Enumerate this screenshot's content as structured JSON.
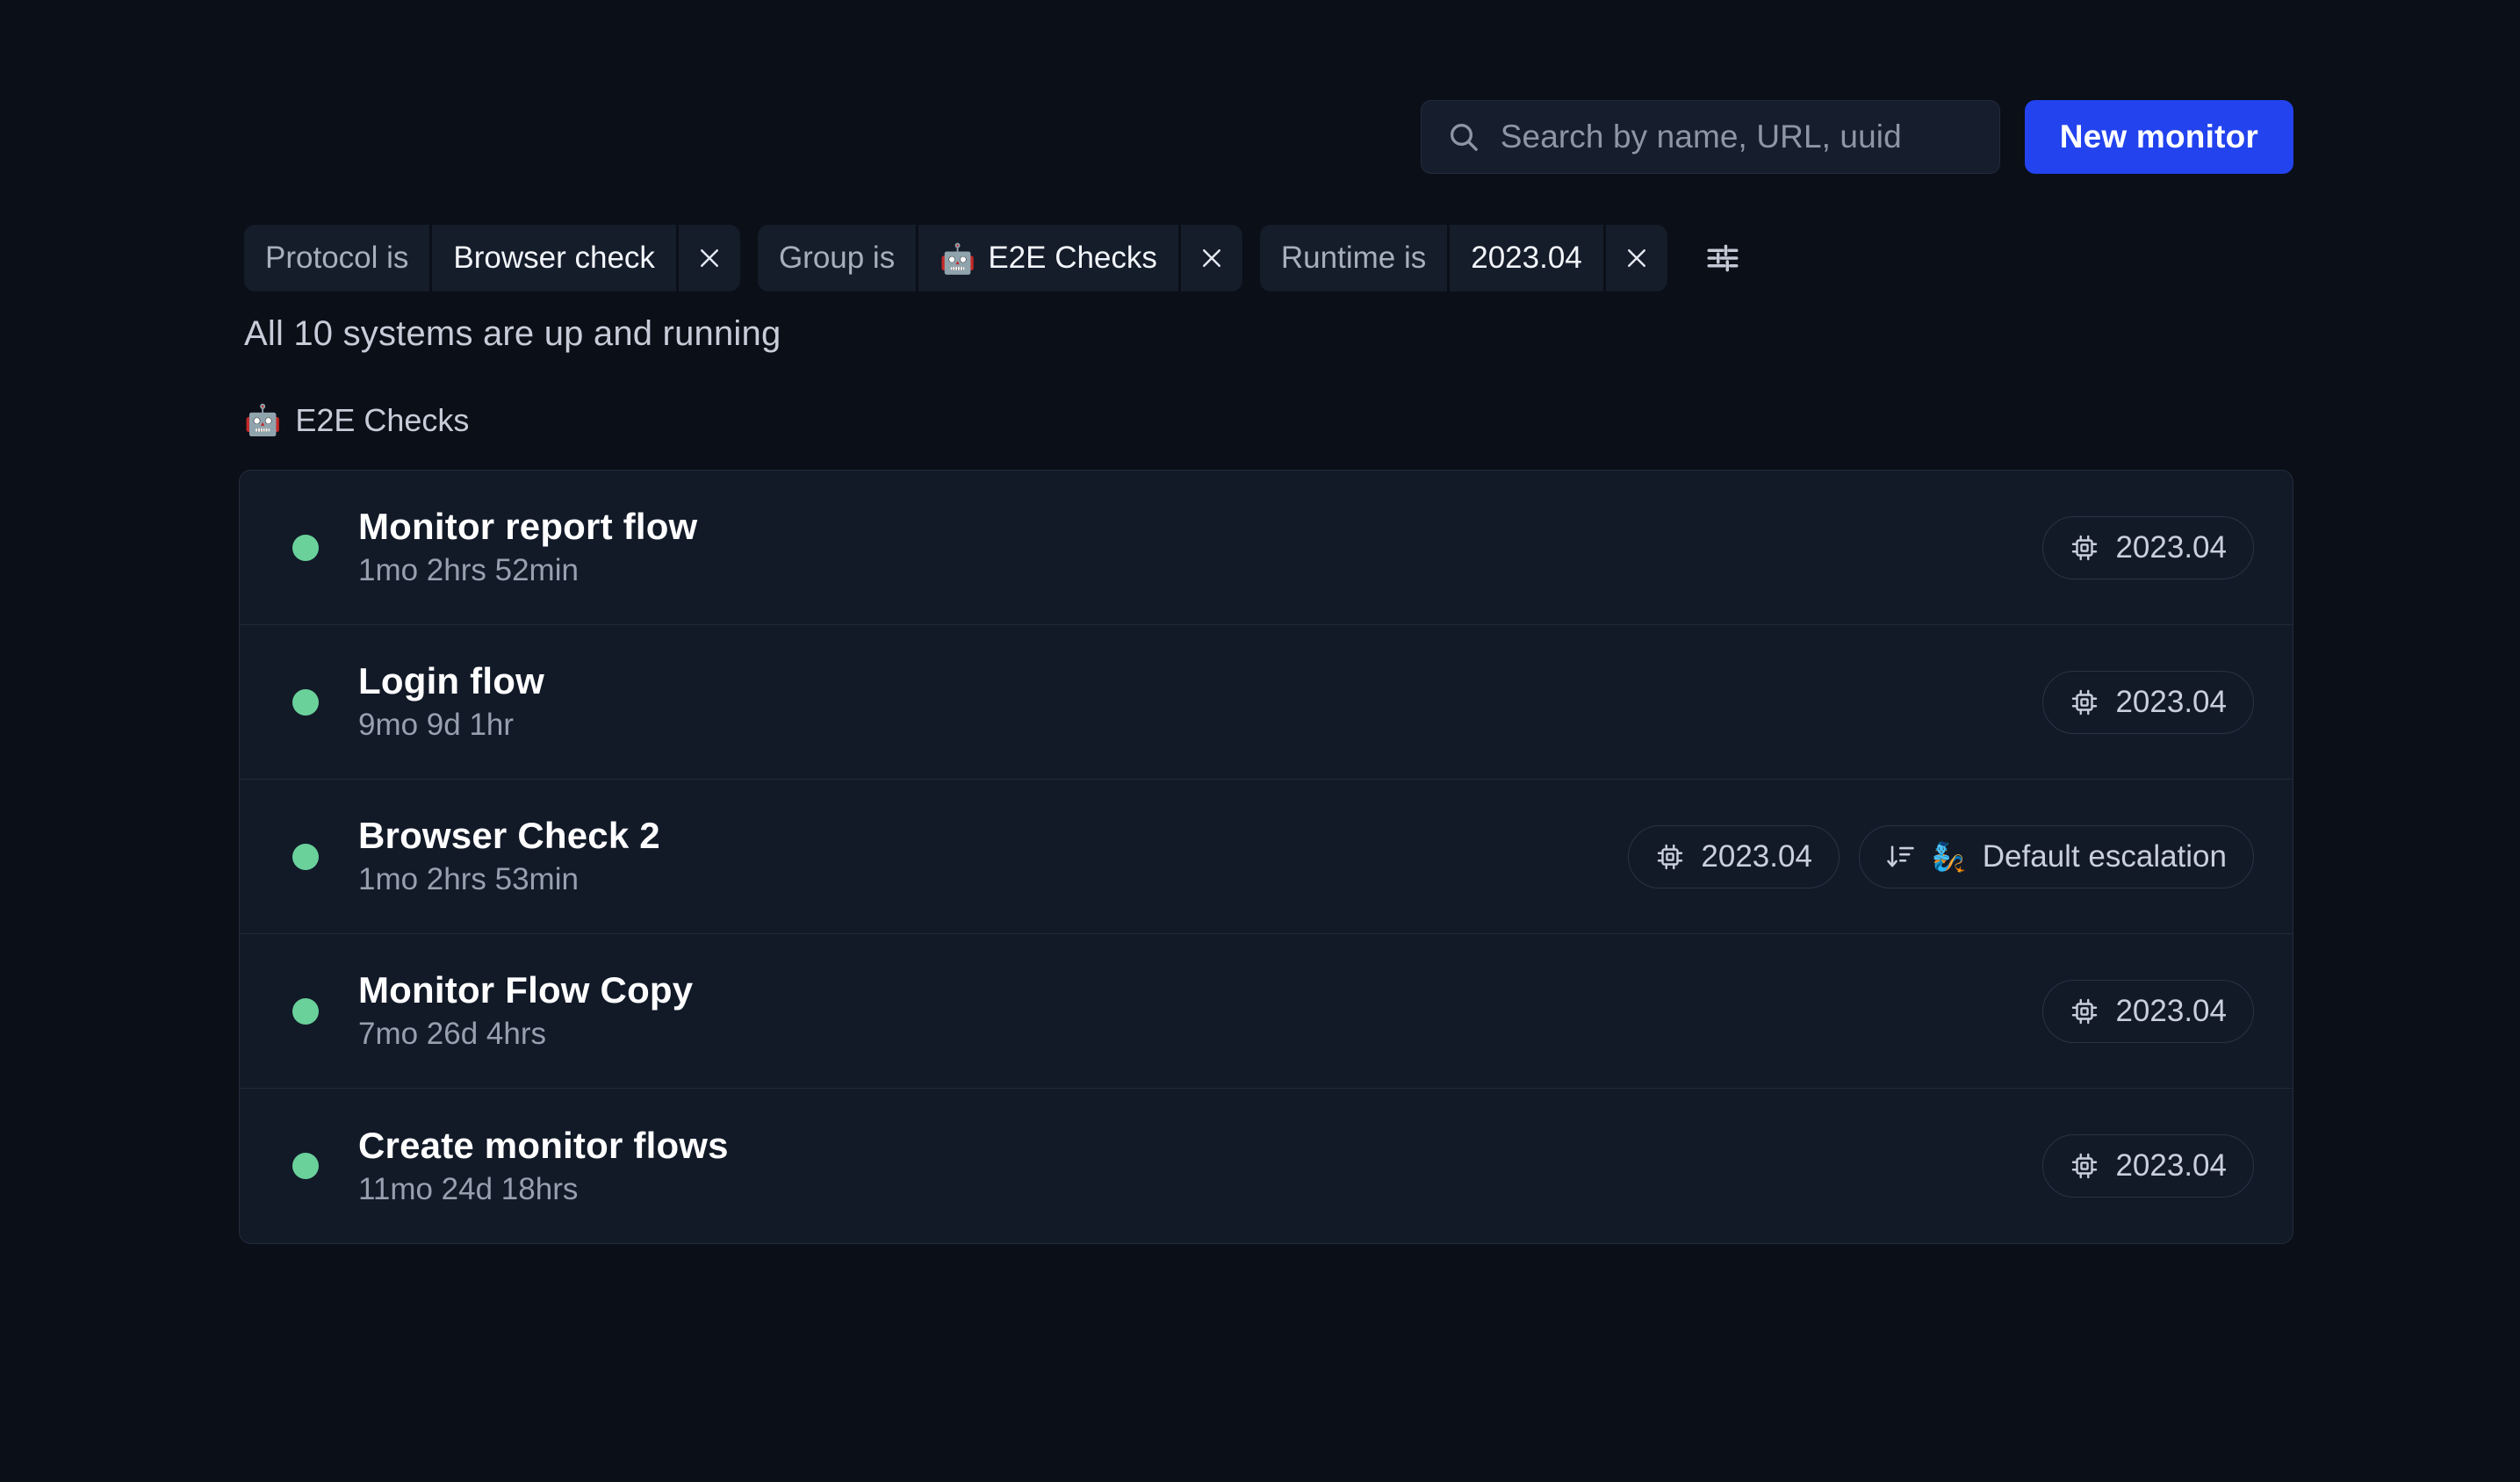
{
  "theme": {
    "page_bg": "#0b0f17",
    "card_bg": "#121a28",
    "chip_bg": "#151c2a",
    "accent_blue": "#2243ee",
    "status_green": "#6ad19b",
    "text_primary": "#ffffff",
    "text_muted": "#98a0b0"
  },
  "toolbar": {
    "search": {
      "icon": "search-icon",
      "placeholder": "Search by name, URL, uuid",
      "value": ""
    },
    "new_monitor_label": "New monitor"
  },
  "filters": {
    "chips": [
      {
        "key": "Protocol is",
        "value": "Browser check",
        "emoji": "",
        "remove_label": "×"
      },
      {
        "key": "Group is",
        "value": "E2E Checks",
        "emoji": "🤖",
        "remove_label": "×"
      },
      {
        "key": "Runtime is",
        "value": "2023.04",
        "emoji": "",
        "remove_label": "×"
      }
    ],
    "settings_icon": "sliders-icon"
  },
  "status": {
    "text": "All 10 systems are up and running"
  },
  "group": {
    "emoji": "🤖",
    "name": "E2E Checks"
  },
  "monitors": [
    {
      "status": "up",
      "name": "Monitor report flow",
      "uptime": "1mo 2hrs 52min",
      "badges": [
        {
          "icon": "cpu-icon",
          "emoji": "",
          "label": "2023.04"
        }
      ]
    },
    {
      "status": "up",
      "name": "Login flow",
      "uptime": "9mo 9d 1hr",
      "badges": [
        {
          "icon": "cpu-icon",
          "emoji": "",
          "label": "2023.04"
        }
      ]
    },
    {
      "status": "up",
      "name": "Browser Check 2",
      "uptime": "1mo 2hrs 53min",
      "badges": [
        {
          "icon": "cpu-icon",
          "emoji": "",
          "label": "2023.04"
        },
        {
          "icon": "sort-descending-icon",
          "emoji": "🧞",
          "label": "Default escalation"
        }
      ]
    },
    {
      "status": "up",
      "name": "Monitor Flow Copy",
      "uptime": "7mo 26d 4hrs",
      "badges": [
        {
          "icon": "cpu-icon",
          "emoji": "",
          "label": "2023.04"
        }
      ]
    },
    {
      "status": "up",
      "name": "Create monitor flows",
      "uptime": "11mo 24d 18hrs",
      "badges": [
        {
          "icon": "cpu-icon",
          "emoji": "",
          "label": "2023.04"
        }
      ]
    }
  ]
}
